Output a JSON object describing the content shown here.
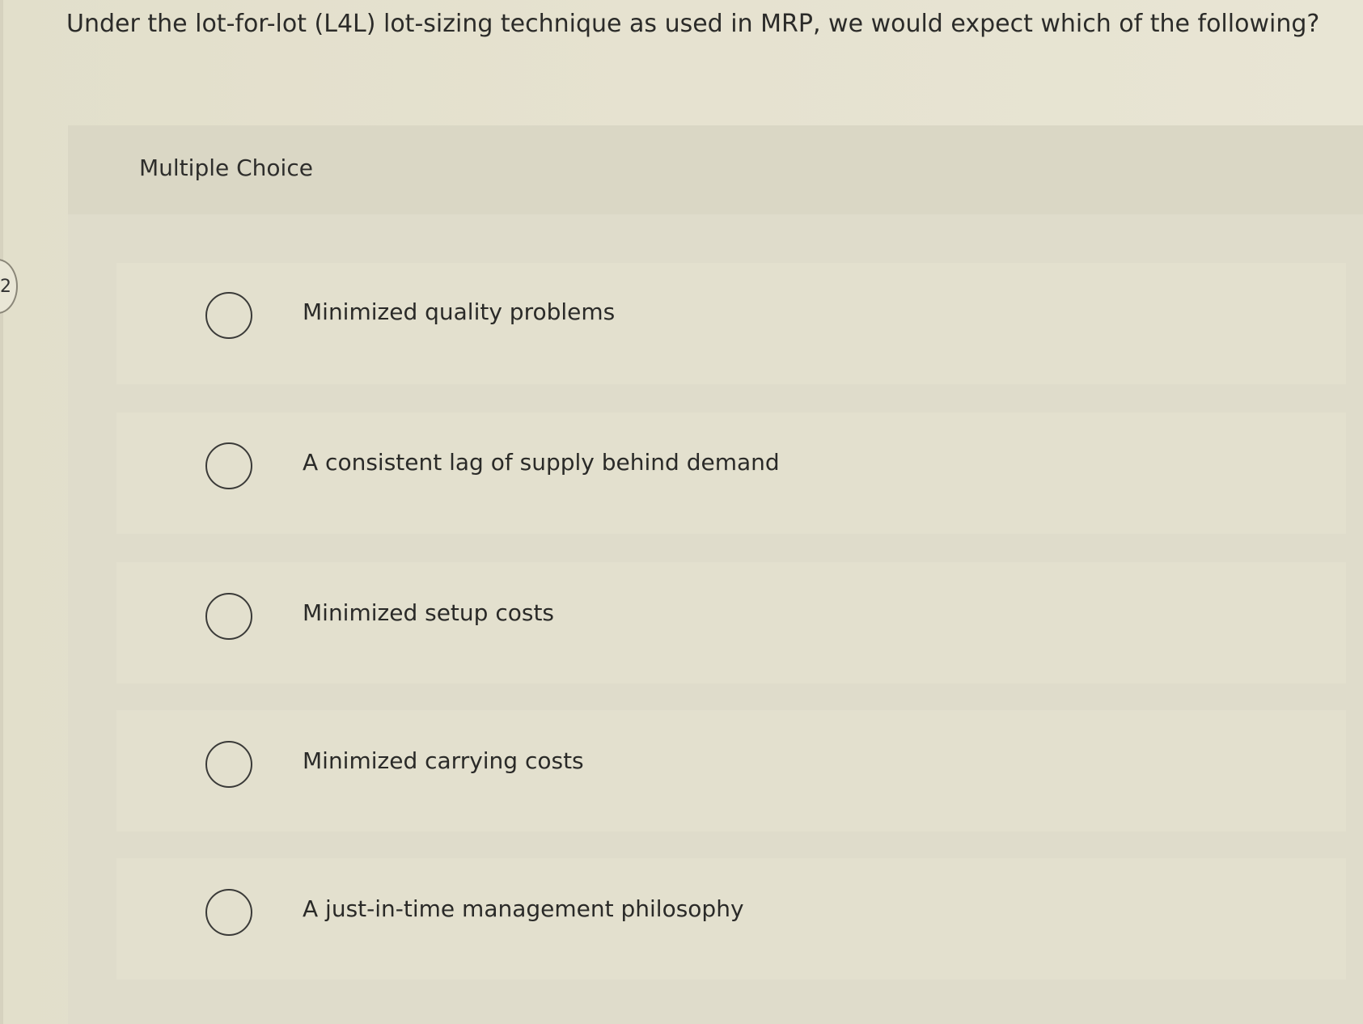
{
  "question_number": "2",
  "question": "Under the lot-for-lot (L4L) lot-sizing technique as used in MRP, we would expect which of the following?",
  "section_title": "Multiple Choice",
  "options": [
    {
      "label": "Minimized quality problems",
      "selected": false
    },
    {
      "label": "A consistent lag of supply behind demand",
      "selected": false
    },
    {
      "label": "Minimized setup costs",
      "selected": false
    },
    {
      "label": "Minimized carrying costs",
      "selected": false
    },
    {
      "label": "A just-in-time management philosophy",
      "selected": false
    }
  ]
}
